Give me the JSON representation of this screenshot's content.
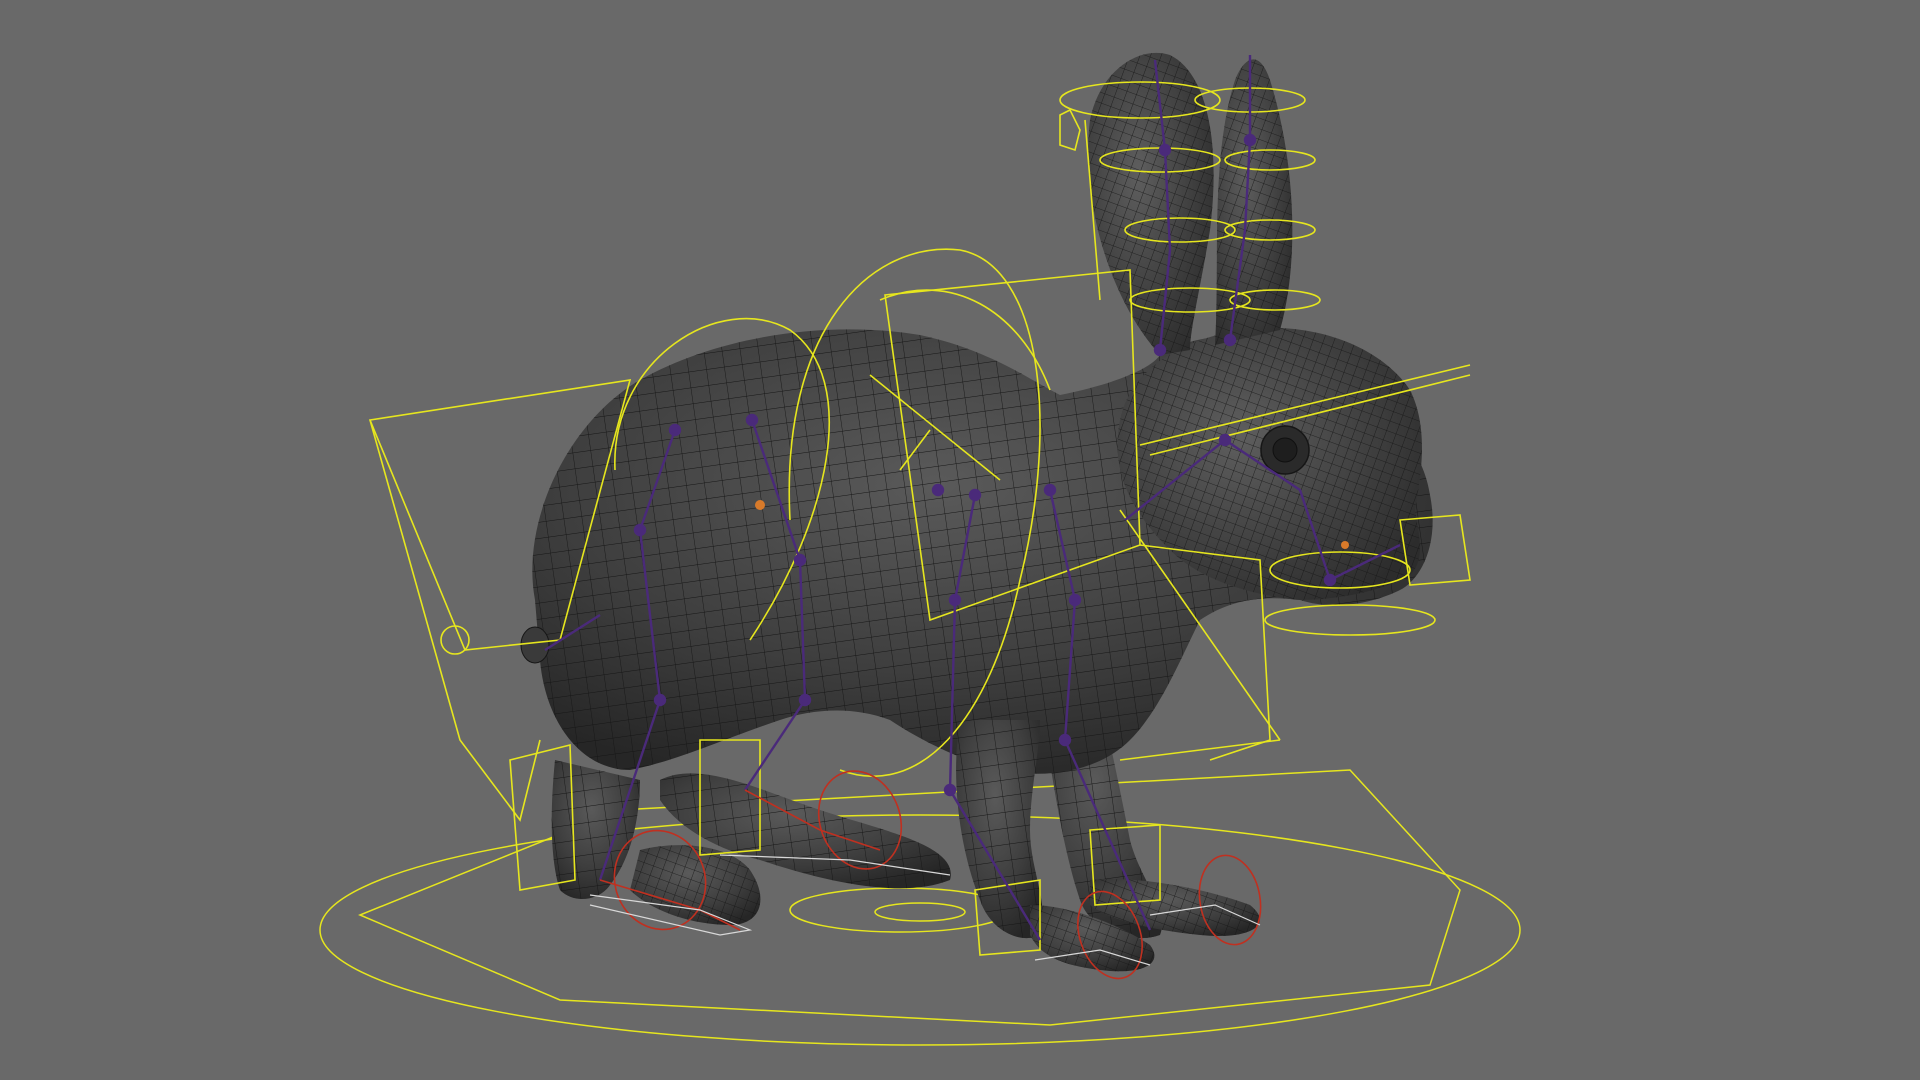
{
  "viewport": {
    "background_color": "#696969",
    "subject": "rabbit-rig",
    "mesh_color": "#3a3a3a",
    "wireframe_color": "#141414",
    "control_curve_color": "#e6e61e",
    "joint_color": "#4a2a7a",
    "ik_handle_color": "#c03020",
    "locator_color": "#d8d8d8"
  }
}
